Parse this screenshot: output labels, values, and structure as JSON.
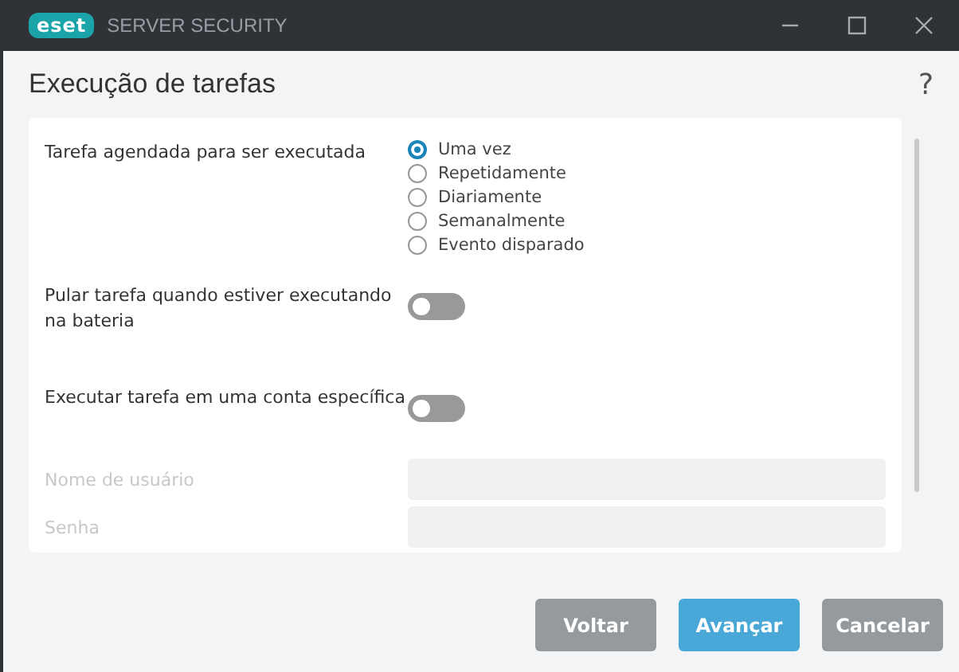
{
  "window": {
    "logo": "eset",
    "product": "SERVER SECURITY"
  },
  "header": {
    "title": "Execução de tarefas",
    "help": "?"
  },
  "schedule": {
    "label": "Tarefa agendada para ser executada",
    "options": [
      {
        "label": "Uma vez",
        "selected": true
      },
      {
        "label": "Repetidamente",
        "selected": false
      },
      {
        "label": "Diariamente",
        "selected": false
      },
      {
        "label": "Semanalmente",
        "selected": false
      },
      {
        "label": "Evento disparado",
        "selected": false
      }
    ]
  },
  "toggles": [
    {
      "label": "Pular tarefa quando estiver executando na bateria",
      "on": false
    },
    {
      "label": "Executar tarefa em uma conta específica",
      "on": false
    }
  ],
  "fields": [
    {
      "label": "Nome de usuário",
      "disabled": true
    },
    {
      "label": "Senha",
      "disabled": true
    }
  ],
  "buttons": [
    {
      "label": "Voltar",
      "kind": "secondary"
    },
    {
      "label": "Avançar",
      "kind": "primary"
    },
    {
      "label": "Cancelar",
      "kind": "secondary"
    }
  ]
}
